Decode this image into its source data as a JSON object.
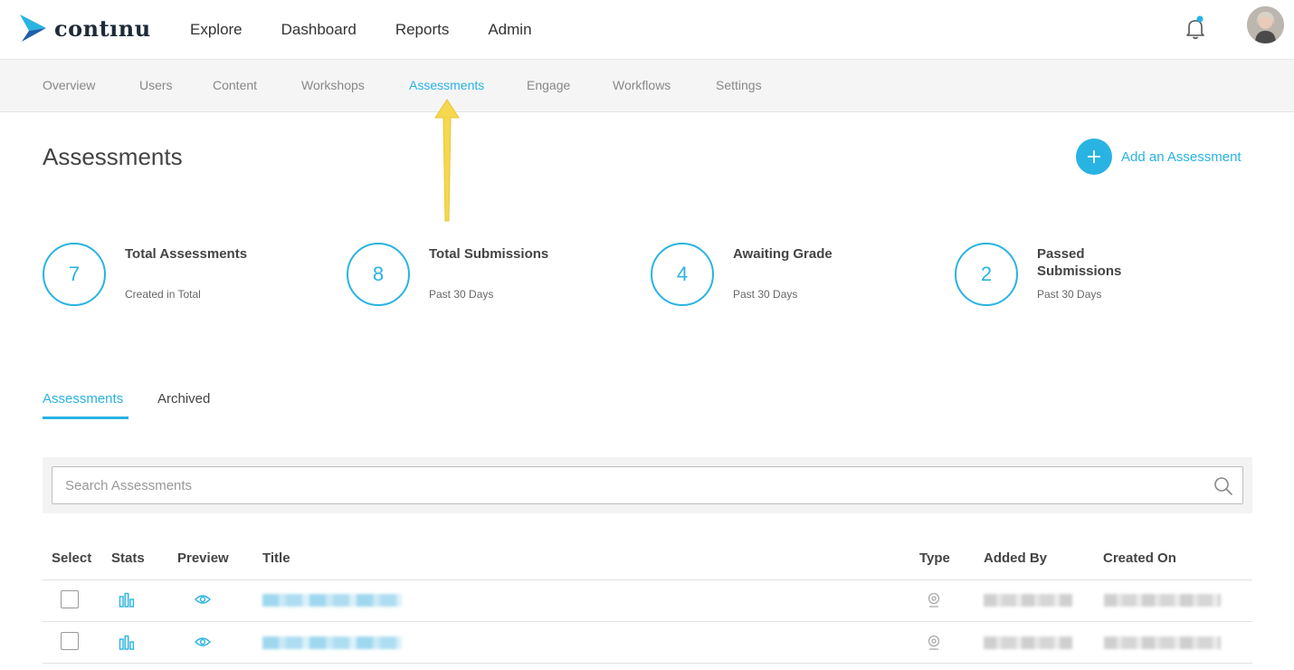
{
  "brand": {
    "name": "contınu"
  },
  "main_nav": [
    {
      "label": "Explore"
    },
    {
      "label": "Dashboard"
    },
    {
      "label": "Reports"
    },
    {
      "label": "Admin"
    }
  ],
  "sub_nav": [
    {
      "label": "Overview"
    },
    {
      "label": "Users"
    },
    {
      "label": "Content"
    },
    {
      "label": "Workshops"
    },
    {
      "label": "Assessments",
      "active": true
    },
    {
      "label": "Engage"
    },
    {
      "label": "Workflows"
    },
    {
      "label": "Settings"
    }
  ],
  "page": {
    "title": "Assessments",
    "add_label": "Add an Assessment"
  },
  "stats": [
    {
      "value": "7",
      "title": "Total Assessments",
      "sub": "Created in Total"
    },
    {
      "value": "8",
      "title": "Total Submissions",
      "sub": "Past 30 Days"
    },
    {
      "value": "4",
      "title": "Awaiting Grade",
      "sub": "Past 30 Days"
    },
    {
      "value": "2",
      "title": "Passed Submissions",
      "sub": "Past 30 Days"
    }
  ],
  "tabs": [
    {
      "label": "Assessments",
      "active": true
    },
    {
      "label": "Archived",
      "active": false
    }
  ],
  "search": {
    "placeholder": "Search Assessments",
    "value": ""
  },
  "table": {
    "columns": [
      "Select",
      "Stats",
      "Preview",
      "Title",
      "Type",
      "Added By",
      "Created On"
    ],
    "rows": [
      {
        "checked": false,
        "type_icon": "webcam-icon"
      },
      {
        "checked": false,
        "type_icon": "webcam-icon"
      }
    ]
  },
  "colors": {
    "accent": "#29b3e2",
    "annotation_arrow": "#f5d84e"
  }
}
